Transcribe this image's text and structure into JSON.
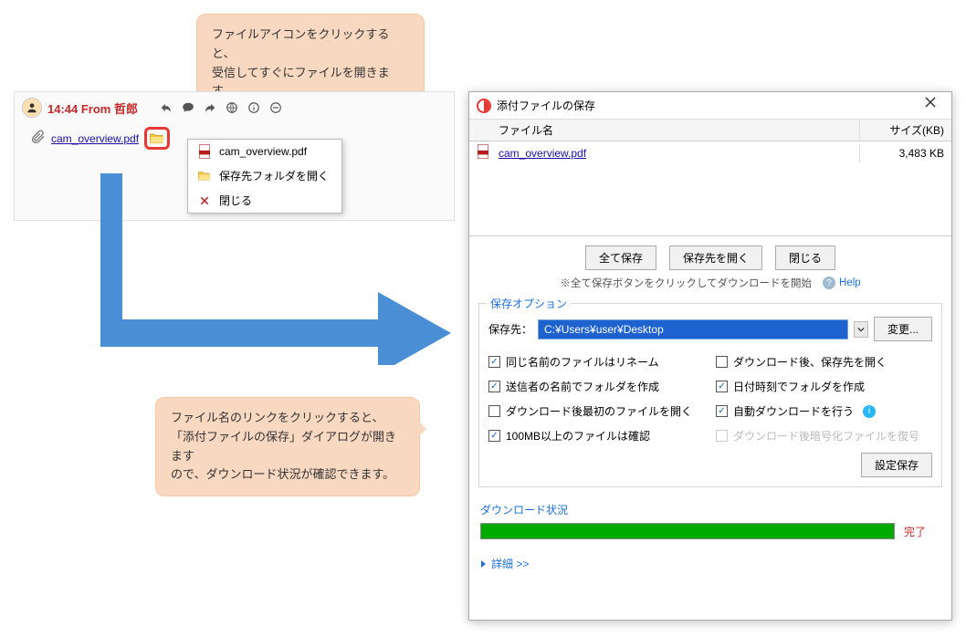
{
  "callout1": {
    "line1": "ファイルアイコンをクリックすると、",
    "line2": "受信してすぐにファイルを開きます。"
  },
  "callout2": {
    "line1": "ファイル名のリンクをクリックすると、",
    "line2": "「添付ファイルの保存」ダイアログが開きます",
    "line3": "ので、ダウンロード状況が確認できます。"
  },
  "chat": {
    "header": "14:44 From  哲郎",
    "file_link": "cam_overview.pdf"
  },
  "ctxmenu": {
    "open_file": "cam_overview.pdf",
    "open_folder": "保存先フォルダを開く",
    "close": "閉じる"
  },
  "dialog": {
    "title": "添付ファイルの保存",
    "filetable": {
      "col_name": "ファイル名",
      "col_size": "サイズ(KB)",
      "rows": [
        {
          "name": "cam_overview.pdf",
          "size": "3,483 KB"
        }
      ]
    },
    "buttons": {
      "save_all": "全て保存",
      "open_dest": "保存先を開く",
      "close": "閉じる"
    },
    "hint": "※全て保存ボタンをクリックしてダウンロードを開始",
    "help": "Help",
    "options": {
      "title": "保存オプション",
      "dest_label": "保存先：",
      "dest_path": "C:¥Users¥user¥Desktop",
      "change": "変更...",
      "chk_rename": {
        "label": "同じ名前のファイルはリネーム",
        "checked": true
      },
      "chk_open_dest": {
        "label": "ダウンロード後、保存先を開く",
        "checked": false
      },
      "chk_sender_folder": {
        "label": "送信者の名前でフォルダを作成",
        "checked": true
      },
      "chk_date_folder": {
        "label": "日付時刻でフォルダを作成",
        "checked": true
      },
      "chk_open_first": {
        "label": "ダウンロード後最初のファイルを開く",
        "checked": false
      },
      "chk_auto_dl": {
        "label": "自動ダウンロードを行う",
        "checked": true
      },
      "chk_confirm_100mb": {
        "label": "100MB以上のファイルは確認",
        "checked": true
      },
      "chk_decrypt": {
        "label": "ダウンロード後暗号化ファイルを復号",
        "checked": false
      },
      "save_settings": "設定保存"
    },
    "download": {
      "title": "ダウンロード状況",
      "status": "完了",
      "details": "詳細 >>"
    }
  }
}
